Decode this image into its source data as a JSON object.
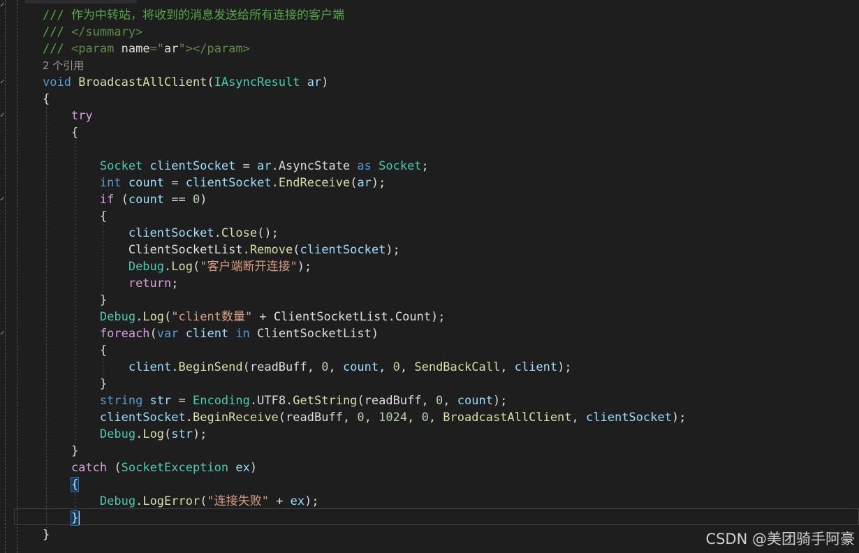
{
  "theme": {
    "background": "#1e1e1e",
    "plain": "#dcdcdc",
    "keyword": "#569cd6",
    "control": "#d8a0df",
    "type": "#4ec9b0",
    "method": "#dcdcaa",
    "string": "#d69d85",
    "number": "#b5cea8",
    "comment": "#57a64a",
    "doc_tag": "#608b4e",
    "variable": "#9cdcfe",
    "codelens": "#999999"
  },
  "icons": {
    "gutter_change_mark": "check-mark-icon"
  },
  "code_lines": [
    [
      [
        "comment",
        "/// 作为中转站，将收到的消息发送给所有连接的客户端"
      ]
    ],
    [
      [
        "comment",
        "/// "
      ],
      [
        "doc_tag",
        "</summary>"
      ]
    ],
    [
      [
        "comment",
        "/// "
      ],
      [
        "doc_tag",
        "<param "
      ],
      [
        "plain",
        "name"
      ],
      [
        "doc_tag",
        "=\""
      ],
      [
        "plain",
        "ar"
      ],
      [
        "doc_tag",
        "\"></param>"
      ]
    ],
    [
      [
        "codelens",
        "2 个引用"
      ]
    ],
    [
      [
        "keyword",
        "void "
      ],
      [
        "method",
        "BroadcastAllClient"
      ],
      [
        "plain",
        "("
      ],
      [
        "type",
        "IAsyncResult "
      ],
      [
        "variable",
        "ar"
      ],
      [
        "plain",
        ")"
      ]
    ],
    [
      [
        "plain",
        "{"
      ]
    ],
    [
      [
        "plain",
        "    "
      ],
      [
        "control",
        "try"
      ]
    ],
    [
      [
        "plain",
        "    {"
      ]
    ],
    [
      [
        "plain",
        ""
      ]
    ],
    [
      [
        "plain",
        "        "
      ],
      [
        "type",
        "Socket "
      ],
      [
        "variable",
        "clientSocket "
      ],
      [
        "plain",
        "= "
      ],
      [
        "variable",
        "ar"
      ],
      [
        "plain",
        ".AsyncState "
      ],
      [
        "keyword",
        "as "
      ],
      [
        "type",
        "Socket"
      ],
      [
        "plain",
        ";"
      ]
    ],
    [
      [
        "plain",
        "        "
      ],
      [
        "keyword",
        "int "
      ],
      [
        "variable",
        "count "
      ],
      [
        "plain",
        "= "
      ],
      [
        "variable",
        "clientSocket"
      ],
      [
        "plain",
        "."
      ],
      [
        "method",
        "EndReceive"
      ],
      [
        "plain",
        "("
      ],
      [
        "variable",
        "ar"
      ],
      [
        "plain",
        ");"
      ]
    ],
    [
      [
        "plain",
        "        "
      ],
      [
        "control",
        "if "
      ],
      [
        "plain",
        "("
      ],
      [
        "variable",
        "count "
      ],
      [
        "plain",
        "== "
      ],
      [
        "number",
        "0"
      ],
      [
        "plain",
        ")"
      ]
    ],
    [
      [
        "plain",
        "        {"
      ]
    ],
    [
      [
        "plain",
        "            "
      ],
      [
        "variable",
        "clientSocket"
      ],
      [
        "plain",
        "."
      ],
      [
        "method",
        "Close"
      ],
      [
        "plain",
        "();"
      ]
    ],
    [
      [
        "plain",
        "            ClientSocketList."
      ],
      [
        "method",
        "Remove"
      ],
      [
        "plain",
        "("
      ],
      [
        "variable",
        "clientSocket"
      ],
      [
        "plain",
        ");"
      ]
    ],
    [
      [
        "plain",
        "            "
      ],
      [
        "type",
        "Debug"
      ],
      [
        "plain",
        "."
      ],
      [
        "method",
        "Log"
      ],
      [
        "plain",
        "("
      ],
      [
        "string",
        "\"客户端断开连接\""
      ],
      [
        "plain",
        ");"
      ]
    ],
    [
      [
        "plain",
        "            "
      ],
      [
        "control",
        "return"
      ],
      [
        "plain",
        ";"
      ]
    ],
    [
      [
        "plain",
        "        }"
      ]
    ],
    [
      [
        "plain",
        "        "
      ],
      [
        "type",
        "Debug"
      ],
      [
        "plain",
        "."
      ],
      [
        "method",
        "Log"
      ],
      [
        "plain",
        "("
      ],
      [
        "string",
        "\"client数量\" "
      ],
      [
        "plain",
        "+ ClientSocketList.Count);"
      ]
    ],
    [
      [
        "plain",
        "        "
      ],
      [
        "control",
        "foreach"
      ],
      [
        "plain",
        "("
      ],
      [
        "keyword",
        "var "
      ],
      [
        "variable",
        "client "
      ],
      [
        "keyword",
        "in "
      ],
      [
        "plain",
        "ClientSocketList)"
      ]
    ],
    [
      [
        "plain",
        "        {"
      ]
    ],
    [
      [
        "plain",
        "            "
      ],
      [
        "variable",
        "client"
      ],
      [
        "plain",
        "."
      ],
      [
        "method",
        "BeginSend"
      ],
      [
        "plain",
        "(readBuff, "
      ],
      [
        "number",
        "0"
      ],
      [
        "plain",
        ", "
      ],
      [
        "variable",
        "count"
      ],
      [
        "plain",
        ", "
      ],
      [
        "number",
        "0"
      ],
      [
        "plain",
        ", "
      ],
      [
        "method",
        "SendBackCall"
      ],
      [
        "plain",
        ", "
      ],
      [
        "variable",
        "client"
      ],
      [
        "plain",
        ");"
      ]
    ],
    [
      [
        "plain",
        "        }"
      ]
    ],
    [
      [
        "plain",
        "        "
      ],
      [
        "keyword",
        "string "
      ],
      [
        "variable",
        "str "
      ],
      [
        "plain",
        "= "
      ],
      [
        "type",
        "Encoding"
      ],
      [
        "plain",
        ".UTF8."
      ],
      [
        "method",
        "GetString"
      ],
      [
        "plain",
        "(readBuff, "
      ],
      [
        "number",
        "0"
      ],
      [
        "plain",
        ", "
      ],
      [
        "variable",
        "count"
      ],
      [
        "plain",
        ");"
      ]
    ],
    [
      [
        "plain",
        "        "
      ],
      [
        "variable",
        "clientSocket"
      ],
      [
        "plain",
        "."
      ],
      [
        "method",
        "BeginReceive"
      ],
      [
        "plain",
        "(readBuff, "
      ],
      [
        "number",
        "0"
      ],
      [
        "plain",
        ", "
      ],
      [
        "number",
        "1024"
      ],
      [
        "plain",
        ", "
      ],
      [
        "number",
        "0"
      ],
      [
        "plain",
        ", "
      ],
      [
        "method",
        "BroadcastAllClient"
      ],
      [
        "plain",
        ", "
      ],
      [
        "variable",
        "clientSocket"
      ],
      [
        "plain",
        ");"
      ]
    ],
    [
      [
        "plain",
        "        "
      ],
      [
        "type",
        "Debug"
      ],
      [
        "plain",
        "."
      ],
      [
        "method",
        "Log"
      ],
      [
        "plain",
        "("
      ],
      [
        "variable",
        "str"
      ],
      [
        "plain",
        ");"
      ]
    ],
    [
      [
        "plain",
        "    }"
      ]
    ],
    [
      [
        "plain",
        "    "
      ],
      [
        "control",
        "catch "
      ],
      [
        "plain",
        "("
      ],
      [
        "type",
        "SocketException "
      ],
      [
        "variable",
        "ex"
      ],
      [
        "plain",
        ")"
      ]
    ],
    [
      [
        "plain",
        "    "
      ],
      [
        "brace",
        "{"
      ]
    ],
    [
      [
        "plain",
        "        "
      ],
      [
        "type",
        "Debug"
      ],
      [
        "plain",
        "."
      ],
      [
        "method",
        "LogError"
      ],
      [
        "plain",
        "("
      ],
      [
        "string",
        "\"连接失败\" "
      ],
      [
        "plain",
        "+ "
      ],
      [
        "variable",
        "ex"
      ],
      [
        "plain",
        ");"
      ]
    ],
    [
      [
        "plain",
        "    "
      ],
      [
        "brace",
        "}"
      ],
      [
        "cursor",
        ""
      ]
    ],
    [
      [
        "plain",
        "}"
      ]
    ]
  ],
  "watermark": "CSDN @美团骑手阿豪"
}
